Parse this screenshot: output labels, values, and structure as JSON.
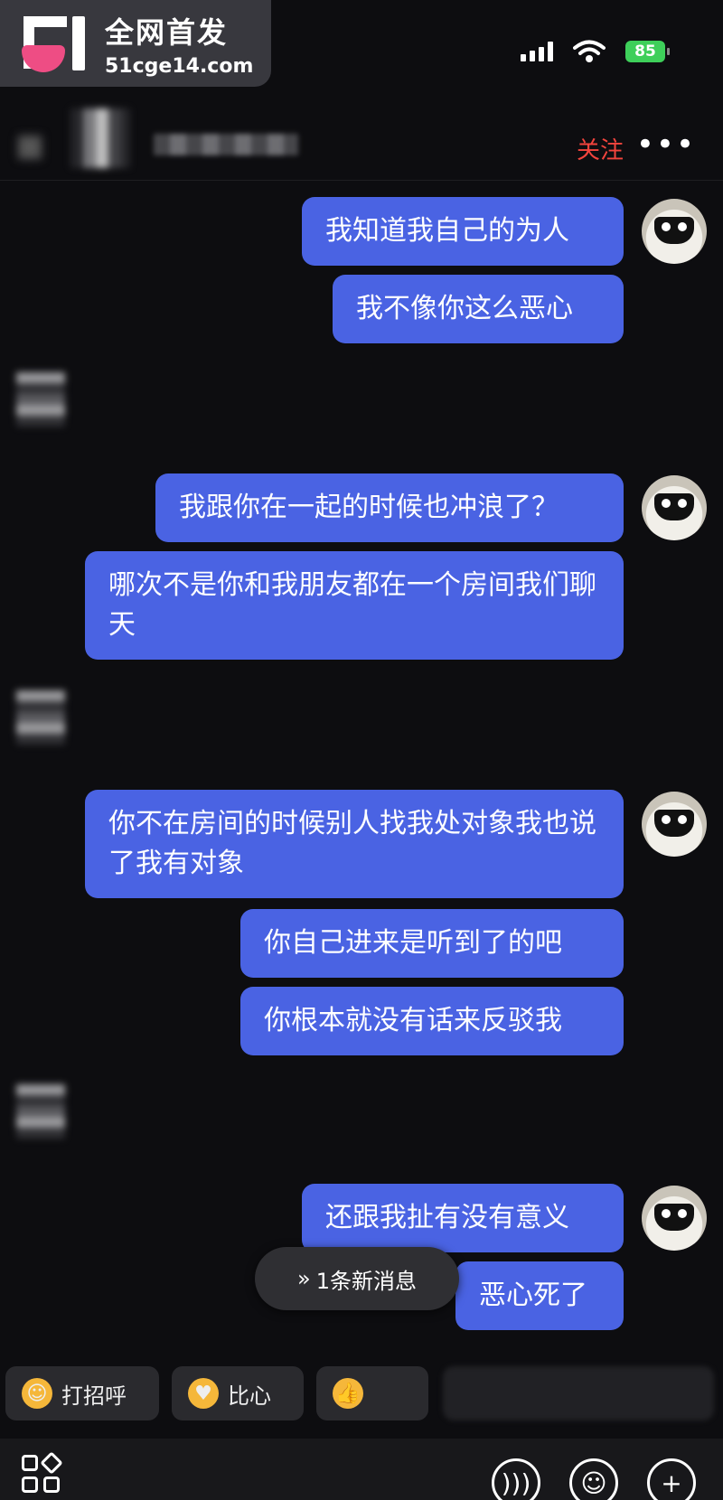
{
  "watermark": {
    "title": "全网首发",
    "url": "51cge14.com"
  },
  "status_bar": {
    "battery": "85"
  },
  "header": {
    "follow_label": "关注",
    "more_label": "•••"
  },
  "messages": [
    {
      "from": "me",
      "text": "我知道我自己的为人"
    },
    {
      "from": "me",
      "text": "我不像你这么恶心"
    },
    {
      "from": "me",
      "text": "我跟你在一起的时候也冲浪了？"
    },
    {
      "from": "me",
      "text": "哪次不是你和我朋友都在一个房间我们聊天"
    },
    {
      "from": "me",
      "text": "你不在房间的时候别人找我处对象我也说了我有对象"
    },
    {
      "from": "me",
      "text": "你自己进来是听到了的吧"
    },
    {
      "from": "me",
      "text": "你根本就没有话来反驳我"
    },
    {
      "from": "me",
      "text": "还跟我扯有没有意义"
    },
    {
      "from": "me",
      "text": "恶心死了"
    }
  ],
  "new_message_pill": {
    "label": "1条新消息",
    "icon": "double-chevron-down-icon"
  },
  "quick_replies": [
    {
      "label": "打招呼",
      "icon": "wave-emoji-icon"
    },
    {
      "label": "比心",
      "icon": "heart-hands-emoji-icon"
    },
    {
      "label": "",
      "icon": "thumbs-up-emoji-icon"
    }
  ],
  "toolbar": {
    "icons": [
      "apps-icon",
      "voice-icon",
      "emoji-icon",
      "plus-icon"
    ]
  },
  "colors": {
    "bubble": "#4a63e3",
    "follow": "#f2443d",
    "background": "#0d0d10"
  }
}
